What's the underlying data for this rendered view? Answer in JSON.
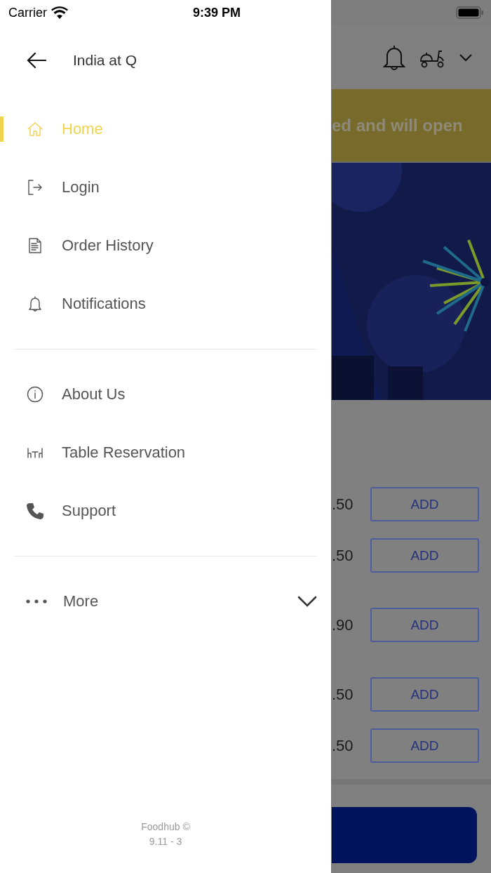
{
  "status_bar": {
    "carrier": "Carrier",
    "time": "9:39 PM"
  },
  "drawer": {
    "title": "India at Q",
    "sections": [
      {
        "items": [
          {
            "label": "Home",
            "kind": "home",
            "selected": true
          },
          {
            "label": "Login",
            "kind": "login",
            "selected": false
          },
          {
            "label": "Order History",
            "kind": "document",
            "selected": false
          },
          {
            "label": "Notifications",
            "kind": "bell",
            "selected": false
          }
        ]
      },
      {
        "items": [
          {
            "label": "About Us",
            "kind": "info",
            "selected": false
          },
          {
            "label": "Table Reservation",
            "kind": "table",
            "selected": false
          },
          {
            "label": "Support",
            "kind": "phone",
            "selected": false
          }
        ]
      }
    ],
    "more": {
      "label": "More",
      "expanded": false
    },
    "footer": [
      "Foodhub ©",
      "9.11 - 3"
    ]
  },
  "background": {
    "banner": "ed and will open",
    "products": [
      {
        "price": ".50",
        "button": "ADD"
      },
      {
        "price": ".50",
        "button": "ADD"
      },
      {
        "price": ".90",
        "button": "ADD"
      },
      {
        "price": ".50",
        "button": "ADD"
      },
      {
        "price": ".50",
        "button": "ADD"
      }
    ]
  }
}
